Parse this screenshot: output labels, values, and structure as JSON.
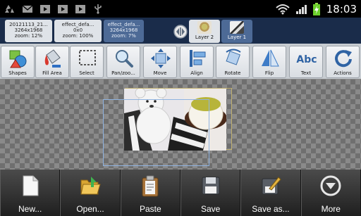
{
  "status_bar": {
    "time": "18:03",
    "left_icons": [
      "recycle-icon",
      "mail-icon",
      "media-icon",
      "media-icon",
      "media-icon",
      "usb-icon"
    ],
    "right_icons": [
      "wifi-icon",
      "signal-icon",
      "battery-icon"
    ]
  },
  "documents": [
    {
      "name": "20121113_21...",
      "size": "3264x1968",
      "zoom": "zoom: 12%",
      "active": false
    },
    {
      "name": "effect_defa...",
      "size": "0x0",
      "zoom": "zoom: 100%",
      "active": false
    },
    {
      "name": "effect_defa...",
      "size": "3264x1968",
      "zoom": "zoom: 7%",
      "active": true
    }
  ],
  "layers": [
    {
      "label": "Layer 2",
      "active": false
    },
    {
      "label": "Layer 1",
      "active": true
    }
  ],
  "toolbar": [
    {
      "label": "Shapes",
      "icon": "shapes-icon"
    },
    {
      "label": "Fill Area",
      "icon": "paint-bucket-icon"
    },
    {
      "label": "Select",
      "icon": "select-icon"
    },
    {
      "label": "Pan/zoo...",
      "icon": "magnifier-icon"
    },
    {
      "label": "Move",
      "icon": "move-icon"
    },
    {
      "label": "Align",
      "icon": "align-icon"
    },
    {
      "label": "Rotate",
      "icon": "rotate-icon"
    },
    {
      "label": "Flip",
      "icon": "flip-icon"
    },
    {
      "label": "Text",
      "icon": "text-icon"
    },
    {
      "label": "Actions",
      "icon": "actions-icon"
    }
  ],
  "text_icon_glyph": "Abc",
  "menu": [
    {
      "label": "New...",
      "icon": "new-document-icon"
    },
    {
      "label": "Open...",
      "icon": "open-folder-icon"
    },
    {
      "label": "Paste",
      "icon": "clipboard-icon"
    },
    {
      "label": "Save",
      "icon": "floppy-disk-icon"
    },
    {
      "label": "Save as...",
      "icon": "save-as-icon"
    },
    {
      "label": "More",
      "icon": "more-icon"
    }
  ],
  "colors": {
    "tabs_bg": "#1a2c4a",
    "active_tab": "#4d6a96",
    "toolbar_bg": "#c7ccd1",
    "menu_bg": "#2c2c2c"
  }
}
